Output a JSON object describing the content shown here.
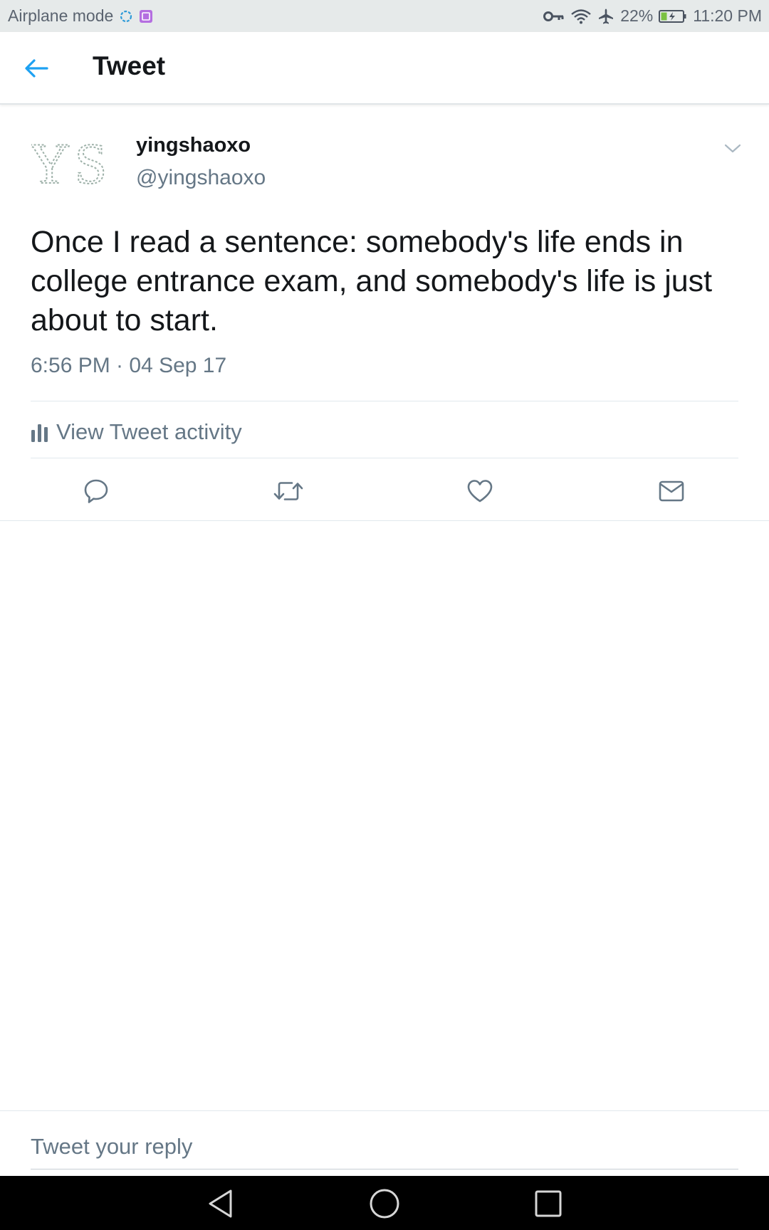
{
  "status_bar": {
    "left_text": "Airplane mode",
    "battery": "22%",
    "time": "11:20 PM",
    "icons": [
      "sync-icon",
      "screenshot-icon",
      "key-icon",
      "wifi-icon",
      "airplane-icon",
      "battery-icon"
    ]
  },
  "header": {
    "title": "Tweet",
    "back_icon": "arrow-left-icon"
  },
  "tweet": {
    "avatar_text": "YS",
    "name": "yingshaoxo",
    "handle": "@yingshaoxo",
    "text": "Once I read a sentence: somebody's life ends in college entrance exam, and somebody's life is just about to start.",
    "timestamp": "6:56 PM · 04 Sep 17",
    "activity_label": "View Tweet activity",
    "actions": [
      "reply-icon",
      "retweet-icon",
      "like-icon",
      "direct-message-icon"
    ]
  },
  "reply": {
    "placeholder": "Tweet your reply"
  },
  "nav_bar": {
    "icons": [
      "back-triangle-icon",
      "home-circle-icon",
      "recents-square-icon"
    ]
  },
  "colors": {
    "accent": "#1da1f2",
    "secondary_text": "#657786",
    "status_bar_bg": "#e6eaea"
  }
}
